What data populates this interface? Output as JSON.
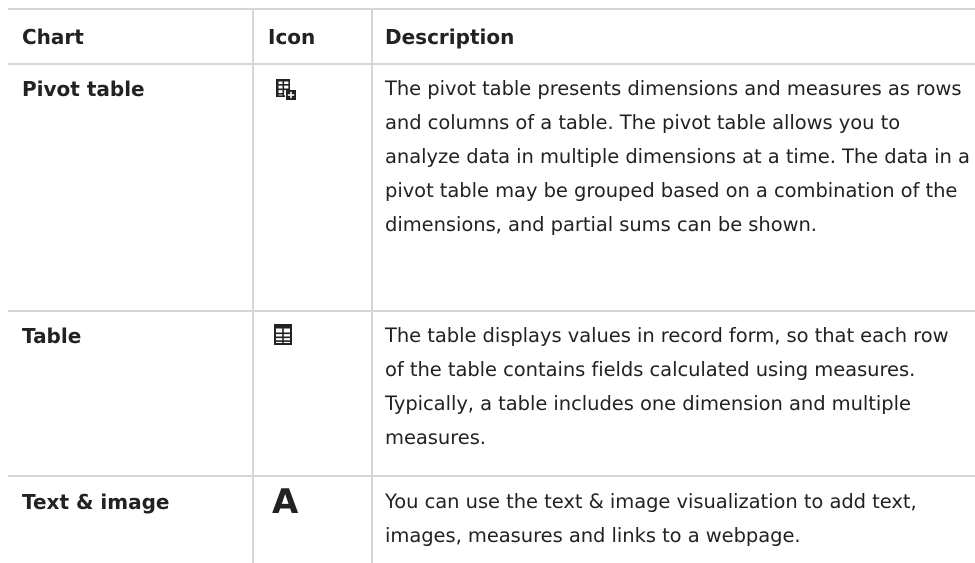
{
  "headers": {
    "chart": "Chart",
    "icon": "Icon",
    "description": "Description"
  },
  "rows": [
    {
      "chart": "Pivot table",
      "icon": "pivot-table-icon",
      "description": "The pivot table presents dimensions and measures as rows and columns of a table. The pivot table allows you to analyze data in multiple dimensions at a time. The data in a pivot table may be grouped based on a combination of the dimensions, and partial sums can be shown."
    },
    {
      "chart": "Table",
      "icon": "table-icon",
      "description": "The table displays values in record form, so that each row of the table contains fields calculated using measures. Typically, a table includes one dimension and multiple measures."
    },
    {
      "chart": "Text & image",
      "icon": "text-image-icon",
      "icon_glyph": "A",
      "description": "You can use the text & image visualization to add text, images, measures and links to a webpage."
    }
  ],
  "colors": {
    "border": "#d6d6d6",
    "text": "#222222",
    "icon": "#222222"
  }
}
